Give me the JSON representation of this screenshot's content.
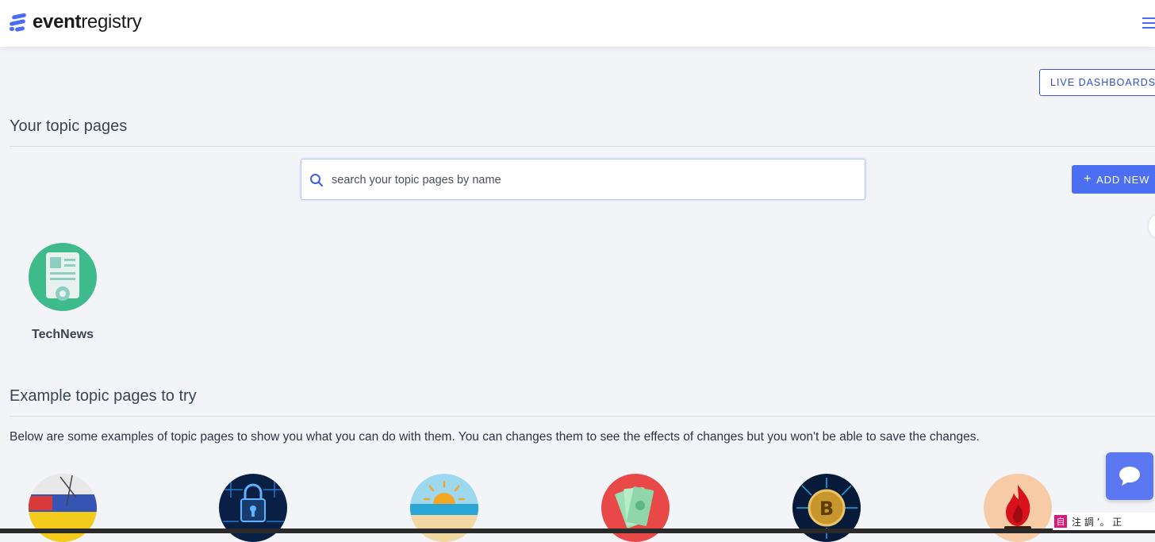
{
  "header": {
    "logo_bold": "event",
    "logo_light": "registry",
    "brand_color": "#4a6cf7"
  },
  "toolbar": {
    "live_dashboards_label": "LIVE DASHBOARDS",
    "add_new_label": "ADD NEW",
    "add_new_icon": "+"
  },
  "your_topics": {
    "title": "Your topic pages",
    "search_placeholder": "search your topic pages by name",
    "search_value": "",
    "items": [
      {
        "name": "TechNews",
        "icon": "document-gear-icon"
      }
    ]
  },
  "examples": {
    "title": "Example topic pages to try",
    "description": "Below are some examples of topic pages to show you what you can do with them. You can changes them to see the effects of changes but you won't be able to save the changes.",
    "items": [
      {
        "icon": "ukraine-flag-icon"
      },
      {
        "icon": "cyber-lock-icon"
      },
      {
        "icon": "beach-sunset-icon"
      },
      {
        "icon": "money-icon"
      },
      {
        "icon": "bitcoin-icon"
      },
      {
        "icon": "fire-icon"
      }
    ]
  },
  "ime": {
    "badge": "自",
    "text": "注 調 ’。 正"
  }
}
